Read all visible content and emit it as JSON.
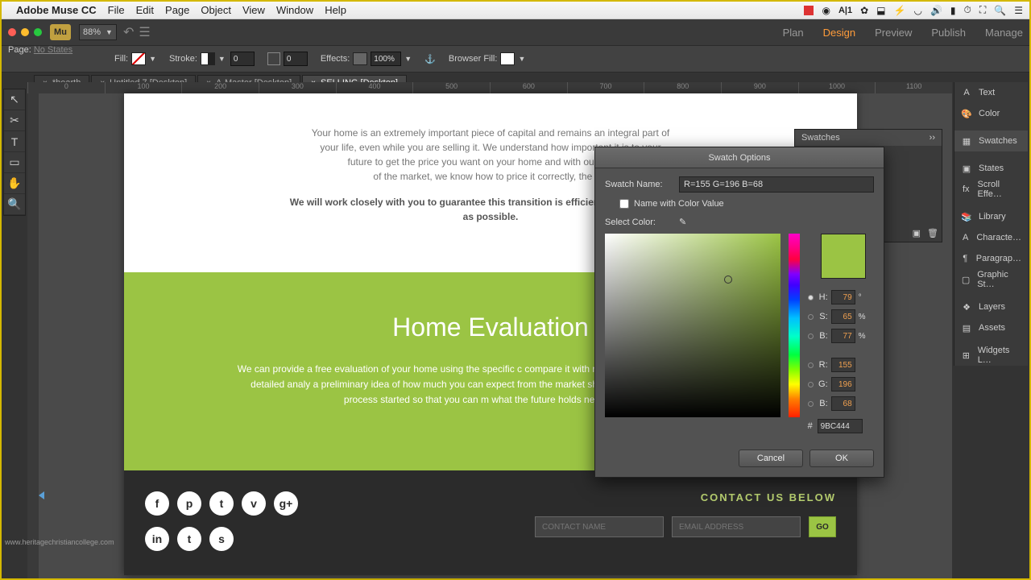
{
  "mac": {
    "apple": "",
    "appname": "Adobe Muse CC",
    "menus": [
      "File",
      "Edit",
      "Page",
      "Object",
      "View",
      "Window",
      "Help"
    ],
    "tray_cc": "1"
  },
  "app": {
    "logo": "Mu",
    "zoom": "88%",
    "tabs": [
      "Plan",
      "Design",
      "Preview",
      "Publish",
      "Manage"
    ],
    "active_tab": "Design"
  },
  "page_state": {
    "label": "Page:",
    "value": "No States"
  },
  "controlbar": {
    "fill": "Fill:",
    "stroke": "Stroke:",
    "stroke_val": "0",
    "corner_val": "0",
    "effects": "Effects:",
    "effects_val": "100%",
    "browserfill": "Browser Fill:"
  },
  "doc_tabs": [
    "*hearth",
    "Untitled 7 [Desktop]",
    "A-Master [Desktop]",
    "SELLING [Desktop]"
  ],
  "ruler_marks": [
    "0",
    "100",
    "200",
    "300",
    "400",
    "500",
    "600",
    "700",
    "800",
    "900",
    "1000",
    "1100"
  ],
  "right_panel": [
    "Text",
    "Color",
    "Swatches",
    "States",
    "Scroll Effe…",
    "Library",
    "Characte…",
    "Paragrap…",
    "Graphic St…",
    "Layers",
    "Assets",
    "Widgets L…"
  ],
  "canvas": {
    "p1": "Your home is an extremely important piece of capital and remains an integral part of",
    "p2": "your life, even while you are selling it. We understand how important it is to your",
    "p3": "future to get the price you want on your home and with our conside",
    "p4": "of the market, we know how to price it correctly, the firs",
    "bold": "We will work closely with you to guarantee this transition is efficiently and successfully as possible.",
    "h1": "Home Evaluation",
    "gp": "We can provide a free evaluation of your home using the specific c compare it with relevant current market prices. This detailed analy a preliminary idea of how much you can expect from the market should aim. Contact us to get this process started so that you can m what the future holds next for you.",
    "contact_h": "CONTACT US BELOW",
    "cname": "CONTACT NAME",
    "cemail": "EMAIL ADDRESS",
    "go": "GO",
    "social": [
      "f",
      "p",
      "t",
      "v",
      "g+",
      "in",
      "t",
      "s"
    ]
  },
  "swatches_panel": {
    "title": "Swatches"
  },
  "dialog": {
    "title": "Swatch Options",
    "name_label": "Swatch Name:",
    "name_value": "R=155 G=196 B=68",
    "name_with_cv": "Name with Color Value",
    "select_color": "Select Color:",
    "H": "79",
    "S": "65",
    "B": "77",
    "R": "155",
    "G": "196",
    "Bv": "68",
    "hex": "9BC444",
    "cancel": "Cancel",
    "ok": "OK"
  },
  "watermark": "www.heritagechristiancollege.com"
}
